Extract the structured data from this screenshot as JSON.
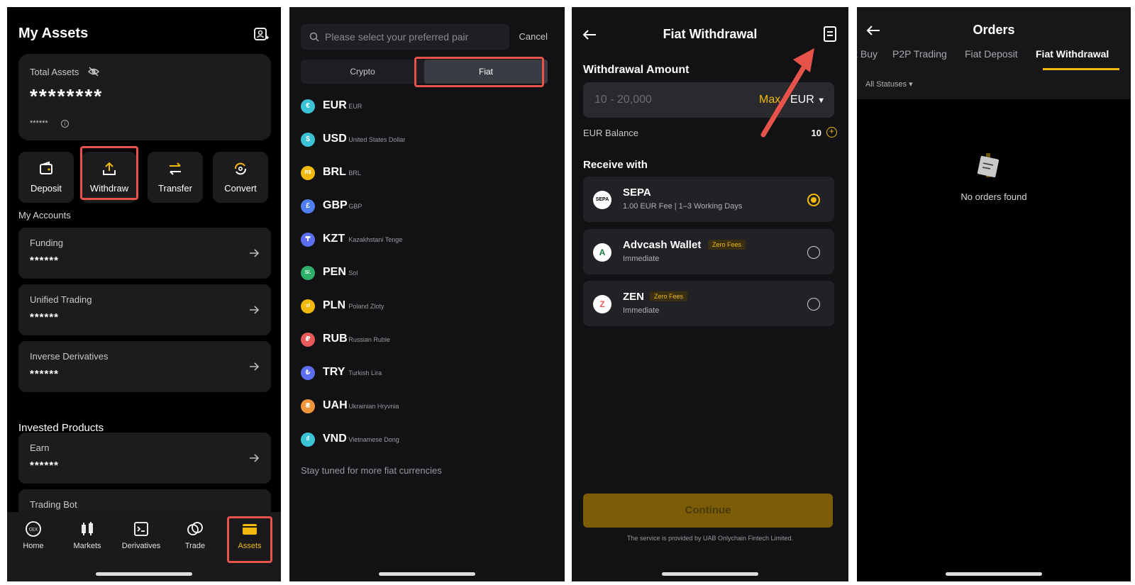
{
  "panel1": {
    "title": "My Assets",
    "total_assets_label": "Total Assets",
    "total_assets_value": "********",
    "total_assets_sub": "******",
    "actions": [
      {
        "label": "Deposit",
        "icon": "deposit-icon"
      },
      {
        "label": "Withdraw",
        "icon": "withdraw-icon"
      },
      {
        "label": "Transfer",
        "icon": "transfer-icon"
      },
      {
        "label": "Convert",
        "icon": "convert-icon"
      }
    ],
    "my_accounts_label": "My Accounts",
    "accounts": [
      {
        "name": "Funding",
        "value": "******"
      },
      {
        "name": "Unified Trading",
        "value": "******"
      },
      {
        "name": "Inverse Derivatives",
        "value": "******"
      }
    ],
    "invested_label": "Invested Products",
    "invested": [
      {
        "name": "Earn",
        "value": "******"
      },
      {
        "name": "Trading Bot",
        "value": ""
      }
    ],
    "tabbar": [
      {
        "label": "Home",
        "icon": "home-icon"
      },
      {
        "label": "Markets",
        "icon": "markets-icon"
      },
      {
        "label": "Derivatives",
        "icon": "derivatives-icon"
      },
      {
        "label": "Trade",
        "icon": "trade-icon"
      },
      {
        "label": "Assets",
        "icon": "wallet-icon"
      }
    ],
    "home_logo_text": "CEX"
  },
  "panel2": {
    "search_placeholder": "Please select your preferred pair",
    "cancel_label": "Cancel",
    "segments": [
      "Crypto",
      "Fiat"
    ],
    "currencies": [
      {
        "code": "EUR",
        "name": "EUR",
        "symbol": "€",
        "color": "#3bc3d5"
      },
      {
        "code": "USD",
        "name": "United States Dollar",
        "symbol": "$",
        "color": "#3bc3d5"
      },
      {
        "code": "BRL",
        "name": "BRL",
        "symbol": "R$",
        "color": "#f0b90b"
      },
      {
        "code": "GBP",
        "name": "GBP",
        "symbol": "£",
        "color": "#4f7ef0"
      },
      {
        "code": "KZT",
        "name": "Kazakhstani Tenge",
        "symbol": "₸",
        "color": "#5c6ef0"
      },
      {
        "code": "PEN",
        "name": "Sol",
        "symbol": "S/.",
        "color": "#2fb06a"
      },
      {
        "code": "PLN",
        "name": "Poland Zloty",
        "symbol": "zł",
        "color": "#f0b90b"
      },
      {
        "code": "RUB",
        "name": "Russian Ruble",
        "symbol": "₽",
        "color": "#e85a5a"
      },
      {
        "code": "TRY",
        "name": "Turkish Lira",
        "symbol": "₺",
        "color": "#5c6ef0"
      },
      {
        "code": "UAH",
        "name": "Ukrainian Hryvnia",
        "symbol": "₴",
        "color": "#f0963a"
      },
      {
        "code": "VND",
        "name": "Vietnamese Dong",
        "symbol": "₫",
        "color": "#3bc3d5"
      }
    ],
    "footer": "Stay tuned for more fiat currencies"
  },
  "panel3": {
    "title": "Fiat Withdrawal",
    "amount_label": "Withdrawal Amount",
    "amount_placeholder": "10 - 20,000",
    "max_label": "Max",
    "currency": "EUR",
    "balance_label": "EUR Balance",
    "balance_value": "10",
    "receive_label": "Receive with",
    "methods": [
      {
        "name": "SEPA",
        "desc": "1.00 EUR Fee  |  1–3 Working Days",
        "badge": "",
        "logo": "SEPA",
        "selected": true
      },
      {
        "name": "Advcash Wallet",
        "desc": "Immediate",
        "badge": "Zero Fees",
        "logo": "A",
        "selected": false
      },
      {
        "name": "ZEN",
        "desc": "Immediate",
        "badge": "Zero Fees",
        "logo": "Z",
        "selected": false
      }
    ],
    "continue_label": "Continue",
    "disclaimer": "The service is provided by UAB Onlychain Fintech Limited."
  },
  "panel4": {
    "title": "Orders",
    "tabs": [
      "k Buy",
      "P2P Trading",
      "Fiat Deposit",
      "Fiat Withdrawal"
    ],
    "status_filter": "All Statuses ▾",
    "empty_text": "No orders found"
  },
  "colors": {
    "accent": "#f0b90b",
    "highlight": "#e5534b"
  }
}
